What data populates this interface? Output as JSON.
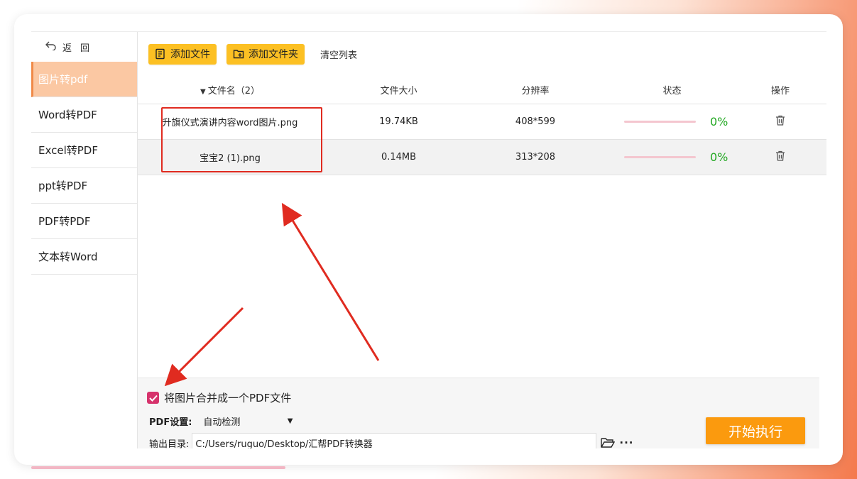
{
  "sidebar": {
    "back_icon": "back-arrow-icon",
    "back_label": "返回",
    "items": [
      {
        "label": "图片转pdf",
        "active": true
      },
      {
        "label": "Word转PDF"
      },
      {
        "label": "Excel转PDF"
      },
      {
        "label": "ppt转PDF"
      },
      {
        "label": "PDF转PDF"
      },
      {
        "label": "文本转Word"
      }
    ]
  },
  "toolbar": {
    "add_file_label": "添加文件",
    "add_folder_label": "添加文件夹",
    "clear_list_label": "清空列表",
    "button_color": "#fcc023"
  },
  "table": {
    "headers": {
      "name": "文件名（2）",
      "size": "文件大小",
      "resolution": "分辨率",
      "status": "状态",
      "action": "操作"
    },
    "rows": [
      {
        "name": "升旗仪式演讲内容word图片.png",
        "size": "19.74KB",
        "resolution": "408*599",
        "progress": 0,
        "percent": "0%"
      },
      {
        "name": "宝宝2 (1).png",
        "size": "0.14MB",
        "resolution": "313*208",
        "progress": 0,
        "percent": "0%"
      }
    ]
  },
  "bottom": {
    "merge_label": "将图片合并成一个PDF文件",
    "merge_checked": true,
    "pdf_settings_label": "PDF设置:",
    "pdf_settings_value": "自动检测",
    "output_label": "输出目录:",
    "output_path": "C:/Users/ruguo/Desktop/汇帮PDF转换器",
    "more_label": "···",
    "start_label": "开始执行",
    "start_color": "#fb9a0e"
  },
  "colors": {
    "accent": "#f08a48",
    "active_nav": "#fbc8a3",
    "checkbox": "#d6336c",
    "percent_text": "#22a822",
    "annotation": "#e02b20"
  }
}
